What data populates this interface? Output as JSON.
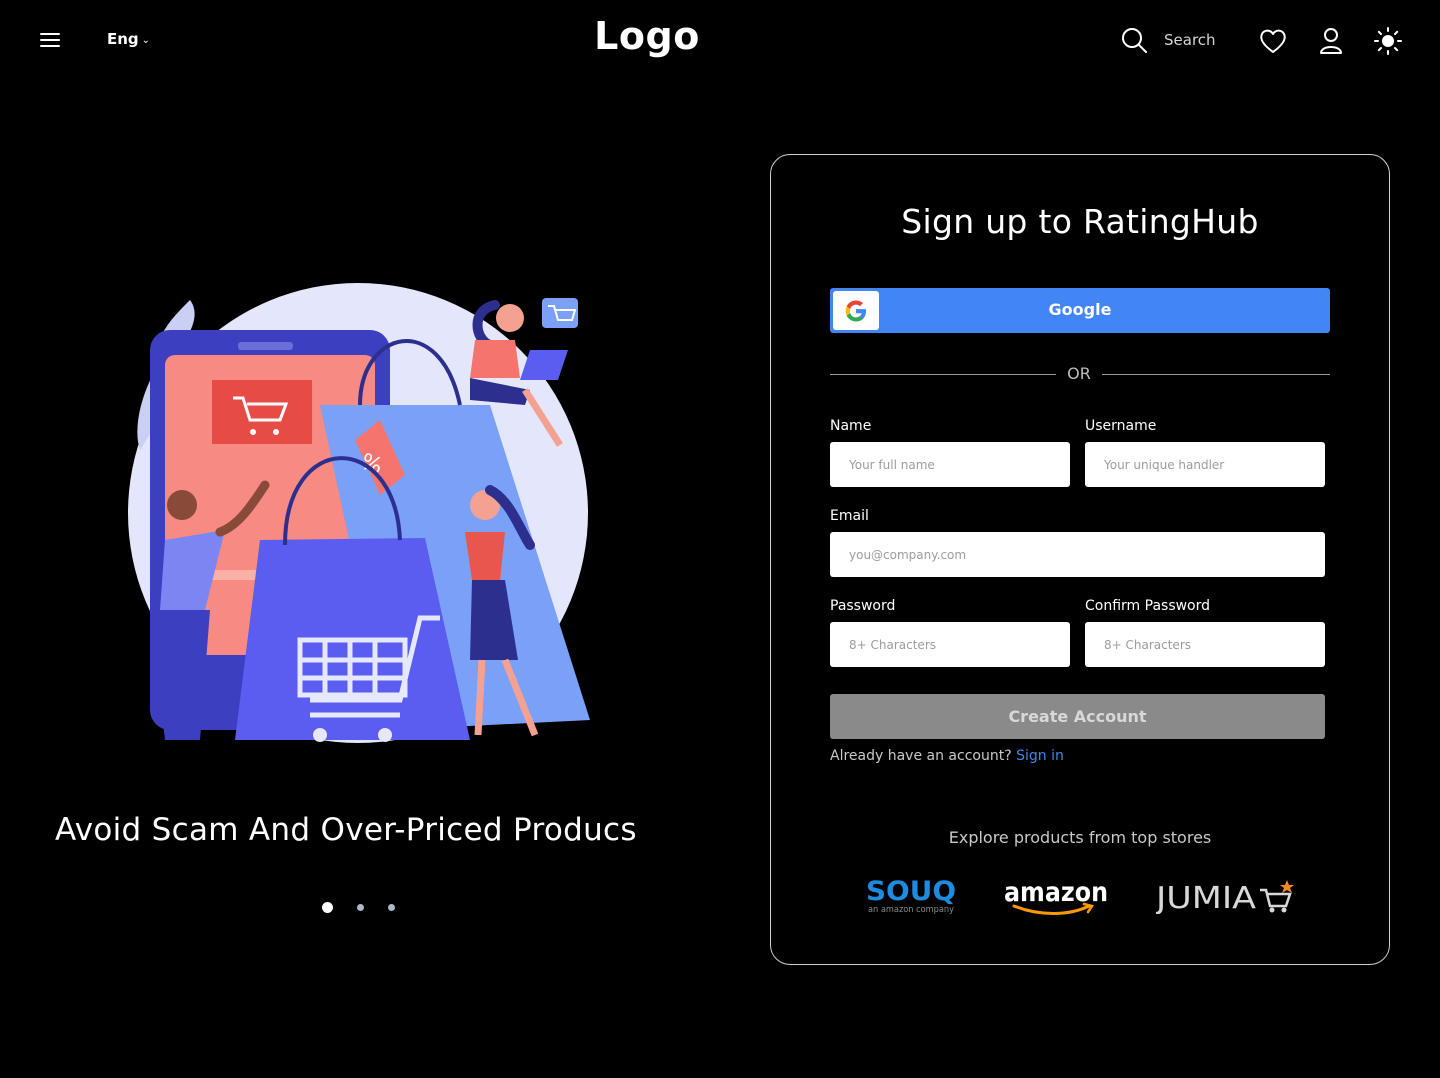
{
  "header": {
    "language": "Eng",
    "logo": "Logo",
    "search_label": "Search"
  },
  "hero": {
    "tagline": "Avoid Scam And Over-Priced Producs",
    "illustration_badge": "%",
    "carousel": {
      "count": 3,
      "active_index": 0
    }
  },
  "signup": {
    "title": "Sign up to RatingHub",
    "google_label": "Google",
    "google_letter": "G",
    "divider_text": "OR",
    "name_label": "Name",
    "name_placeholder": "Your full name",
    "username_label": "Username",
    "username_placeholder": "Your unique handler",
    "email_label": "Email",
    "email_placeholder": "you@company.com",
    "password_label": "Password",
    "password_placeholder": "8+ Characters",
    "confirm_label": "Confirm Password",
    "confirm_placeholder": "8+ Characters",
    "create_label": "Create Account",
    "already_text": "Already have an account?",
    "signin_link": "Sign in"
  },
  "stores": {
    "heading": "Explore products from top stores",
    "items": [
      {
        "name": "SOUQ",
        "sub": "an amazon company",
        "color": "#1d8ce0"
      },
      {
        "name": "amazon",
        "color": "#ffffff",
        "accent": "#f90"
      },
      {
        "name": "JUMIA",
        "color": "#d8d8d8",
        "accent": "#f68b1e"
      }
    ]
  },
  "colors": {
    "background": "#000000",
    "accent": "#4285f4",
    "button_disabled": "#8a8a8a"
  }
}
